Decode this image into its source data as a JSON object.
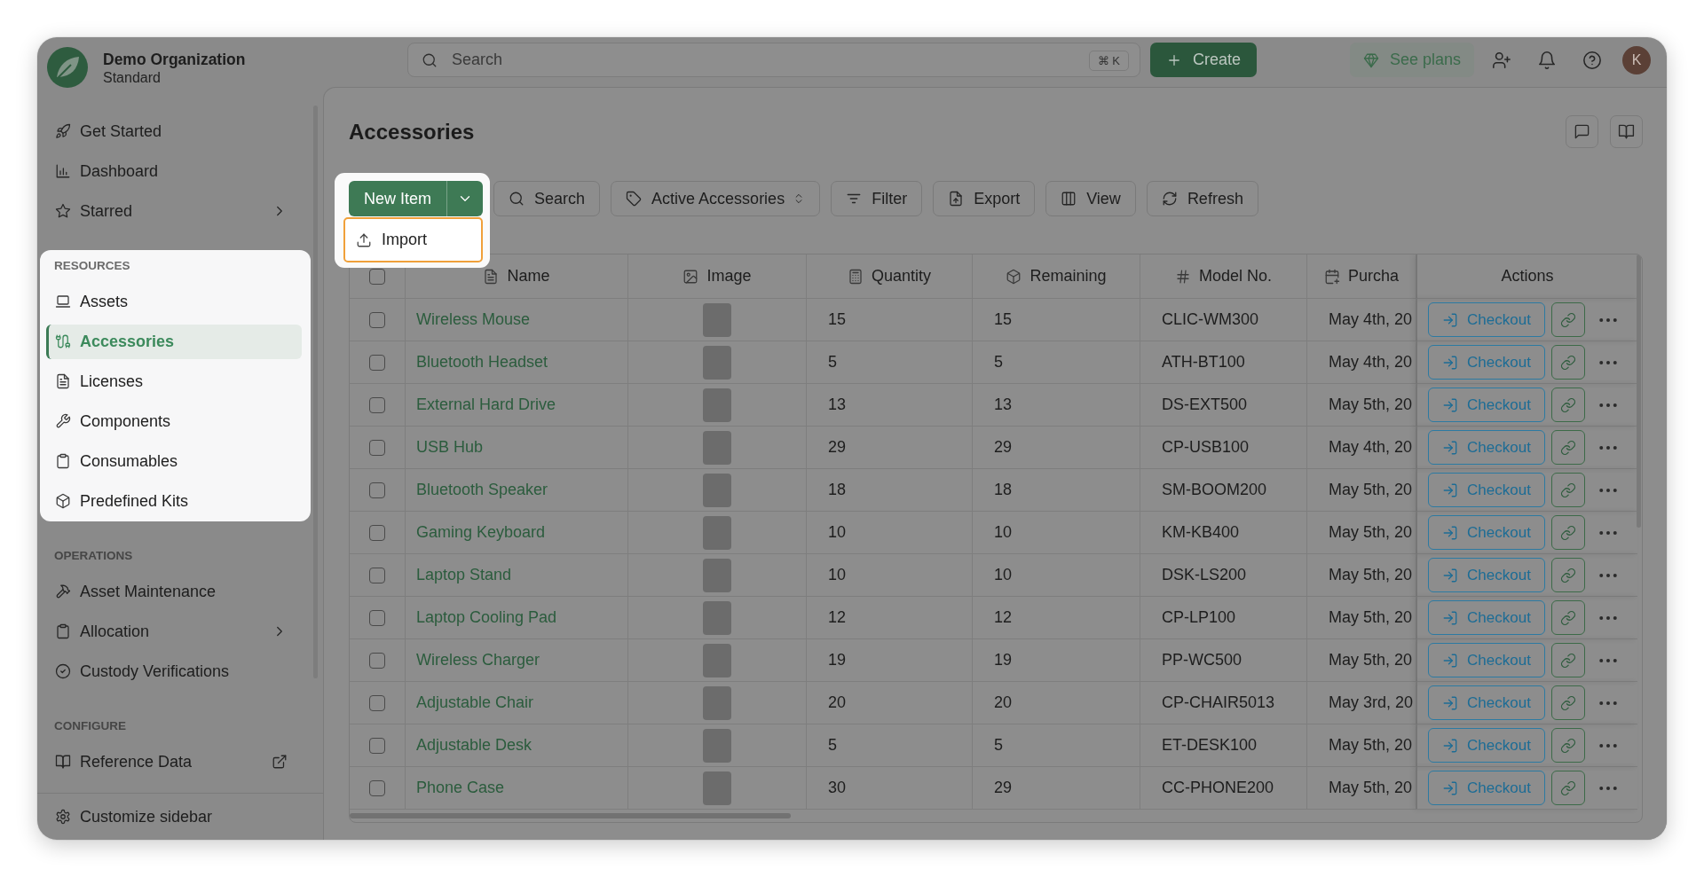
{
  "organization": {
    "name": "Demo Organization",
    "plan": "Standard"
  },
  "topbar": {
    "search": {
      "placeholder": "Search",
      "shortcut": "⌘ K"
    },
    "create_button": "Create",
    "see_plans_button": "See plans",
    "avatar_initial": "K"
  },
  "sidebar": {
    "items": [
      {
        "label": "Get Started",
        "selected": false,
        "submenu": false,
        "external": false
      },
      {
        "label": "Dashboard",
        "selected": false,
        "submenu": false,
        "external": false
      },
      {
        "label": "Starred",
        "selected": false,
        "submenu": true,
        "external": false
      }
    ],
    "sections": [
      {
        "title": "RESOURCES",
        "spotlight": true,
        "items": [
          {
            "label": "Assets",
            "selected": false,
            "submenu": false,
            "external": false
          },
          {
            "label": "Accessories",
            "selected": true,
            "submenu": false,
            "external": false
          },
          {
            "label": "Licenses",
            "selected": false,
            "submenu": false,
            "external": false
          },
          {
            "label": "Components",
            "selected": false,
            "submenu": false,
            "external": false
          },
          {
            "label": "Consumables",
            "selected": false,
            "submenu": false,
            "external": false
          },
          {
            "label": "Predefined Kits",
            "selected": false,
            "submenu": false,
            "external": false
          }
        ]
      },
      {
        "title": "OPERATIONS",
        "spotlight": false,
        "items": [
          {
            "label": "Asset Maintenance",
            "selected": false,
            "submenu": false,
            "external": false
          },
          {
            "label": "Allocation",
            "selected": false,
            "submenu": true,
            "external": false
          },
          {
            "label": "Custody Verifications",
            "selected": false,
            "submenu": false,
            "external": false
          }
        ]
      },
      {
        "title": "CONFIGURE",
        "spotlight": false,
        "items": [
          {
            "label": "Reference Data",
            "selected": false,
            "submenu": false,
            "external": true
          }
        ]
      }
    ],
    "footer": "Customize sidebar"
  },
  "page": {
    "title": "Accessories"
  },
  "toolbar": {
    "new_item": {
      "label": "New Item",
      "spotlight": true,
      "expanded": true,
      "menu": [
        {
          "label": "Import",
          "highlighted": true
        }
      ]
    },
    "buttons": [
      {
        "label": "Search",
        "kind": "button"
      },
      {
        "label": "Active Accessories",
        "kind": "select"
      },
      {
        "label": "Filter",
        "kind": "button"
      },
      {
        "label": "Export",
        "kind": "button"
      },
      {
        "label": "View",
        "kind": "button"
      },
      {
        "label": "Refresh",
        "kind": "button"
      }
    ]
  },
  "table": {
    "select_all_checked": false,
    "columns": [
      "Name",
      "Image",
      "Quantity",
      "Remaining",
      "Model No.",
      "Purcha",
      "Actions"
    ],
    "rows": [
      {
        "checked": false,
        "name": "Wireless Mouse",
        "quantity": "15",
        "remaining": "15",
        "model_no": "CLIC-WM300",
        "column_7": "May 4th, 20",
        "action": "Checkout"
      },
      {
        "checked": false,
        "name": "Bluetooth Headset",
        "quantity": "5",
        "remaining": "5",
        "model_no": "ATH-BT100",
        "column_7": "May 4th, 20",
        "action": "Checkout"
      },
      {
        "checked": false,
        "name": "External Hard Drive",
        "quantity": "13",
        "remaining": "13",
        "model_no": "DS-EXT500",
        "column_7": "May 5th, 20",
        "action": "Checkout"
      },
      {
        "checked": false,
        "name": "USB Hub",
        "quantity": "29",
        "remaining": "29",
        "model_no": "CP-USB100",
        "column_7": "May 4th, 20",
        "action": "Checkout"
      },
      {
        "checked": false,
        "name": "Bluetooth Speaker",
        "quantity": "18",
        "remaining": "18",
        "model_no": "SM-BOOM200",
        "column_7": "May 5th, 20",
        "action": "Checkout"
      },
      {
        "checked": false,
        "name": "Gaming Keyboard",
        "quantity": "10",
        "remaining": "10",
        "model_no": "KM-KB400",
        "column_7": "May 5th, 20",
        "action": "Checkout"
      },
      {
        "checked": false,
        "name": "Laptop Stand",
        "quantity": "10",
        "remaining": "10",
        "model_no": "DSK-LS200",
        "column_7": "May 5th, 20",
        "action": "Checkout"
      },
      {
        "checked": false,
        "name": "Laptop Cooling Pad",
        "quantity": "12",
        "remaining": "12",
        "model_no": "CP-LP100",
        "column_7": "May 5th, 20",
        "action": "Checkout"
      },
      {
        "checked": false,
        "name": "Wireless Charger",
        "quantity": "19",
        "remaining": "19",
        "model_no": "PP-WC500",
        "column_7": "May 5th, 20",
        "action": "Checkout"
      },
      {
        "checked": false,
        "name": "Adjustable Chair",
        "quantity": "20",
        "remaining": "20",
        "model_no": "CP-CHAIR5013",
        "column_7": "May 3rd, 20",
        "action": "Checkout"
      },
      {
        "checked": false,
        "name": "Adjustable Desk",
        "quantity": "5",
        "remaining": "5",
        "model_no": "ET-DESK100",
        "column_7": "May 5th, 20",
        "action": "Checkout"
      },
      {
        "checked": false,
        "name": "Phone Case",
        "quantity": "30",
        "remaining": "29",
        "model_no": "CC-PHONE200",
        "column_7": "May 5th, 20",
        "action": "Checkout"
      }
    ]
  }
}
